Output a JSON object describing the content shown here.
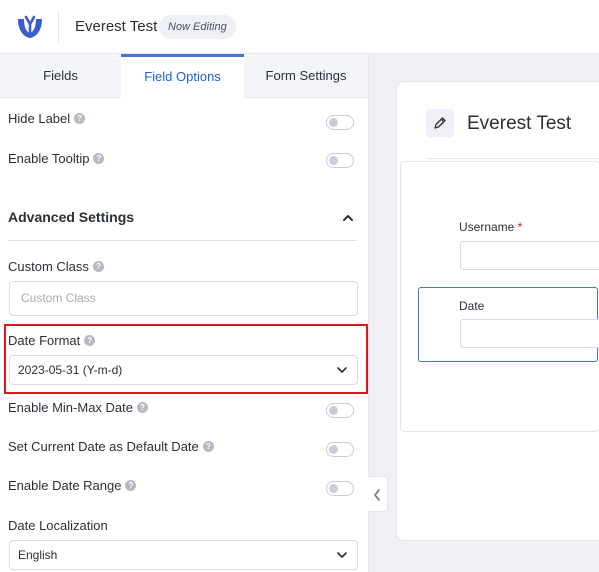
{
  "header": {
    "app_title": "Everest Test",
    "badge": "Now Editing"
  },
  "tabs": [
    {
      "label": "Fields"
    },
    {
      "label": "Field Options"
    },
    {
      "label": "Form Settings"
    }
  ],
  "options": {
    "hide_label": "Hide Label",
    "enable_tooltip": "Enable Tooltip",
    "advanced_settings": "Advanced Settings",
    "custom_class": {
      "label": "Custom Class",
      "placeholder": "Custom Class"
    },
    "date_format": {
      "label": "Date Format",
      "value": "2023-05-31 (Y-m-d)"
    },
    "enable_min_max": "Enable Min-Max Date",
    "set_current_date": "Set Current Date as Default Date",
    "enable_date_range": "Enable Date Range",
    "date_localization": {
      "label": "Date Localization",
      "value": "English"
    }
  },
  "form": {
    "title": "Everest Test",
    "fields": [
      {
        "label": "Username",
        "required": "*"
      },
      {
        "label": "Date"
      }
    ]
  },
  "colors": {
    "accent": "#4a72d4",
    "highlight": "#e0141e",
    "logo": "#3b5ccc"
  },
  "icons": [
    "logo-icon",
    "help-icon",
    "chevron-up-icon",
    "chevron-down-icon",
    "pencil-icon",
    "chevron-left-icon"
  ]
}
